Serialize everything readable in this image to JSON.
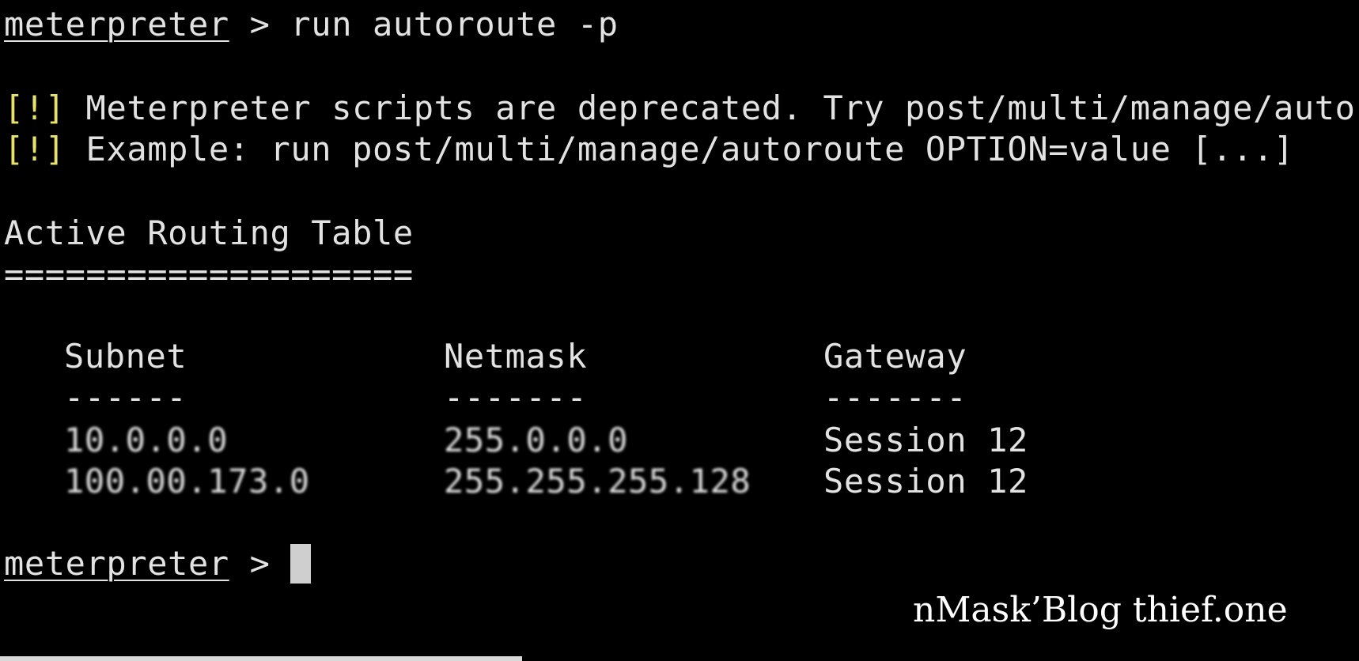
{
  "terminal": {
    "command_line": {
      "prompt": "meterpreter",
      "separator": " > ",
      "command": "run autoroute -p"
    },
    "warnings": [
      {
        "tag": "[!]",
        "text": " Meterpreter scripts are deprecated. Try post/multi/manage/autoro"
      },
      {
        "tag": "[!]",
        "text": " Example: run post/multi/manage/autoroute OPTION=value [...]"
      }
    ],
    "table_title": "Active Routing Table",
    "table_title_underline": "====================",
    "headers": {
      "subnet": "Subnet",
      "netmask": "Netmask",
      "gateway": "Gateway"
    },
    "header_underlines": {
      "subnet": "------",
      "netmask": "-------",
      "gateway": "-------"
    },
    "rows": [
      {
        "subnet": "10.0.0.0",
        "netmask": "255.0.0.0",
        "gateway": "Session 12"
      },
      {
        "subnet": "100.00.173.0",
        "netmask": "255.255.255.128",
        "gateway": "Session 12"
      }
    ],
    "final_prompt": {
      "prompt": "meterpreter",
      "separator": " > "
    }
  },
  "watermark": "nMask’Blog thief.one",
  "colors": {
    "background": "#000000",
    "text": "#e2e2e2",
    "warning_tag": "#e8e26a",
    "cursor": "#cfcfcf"
  }
}
